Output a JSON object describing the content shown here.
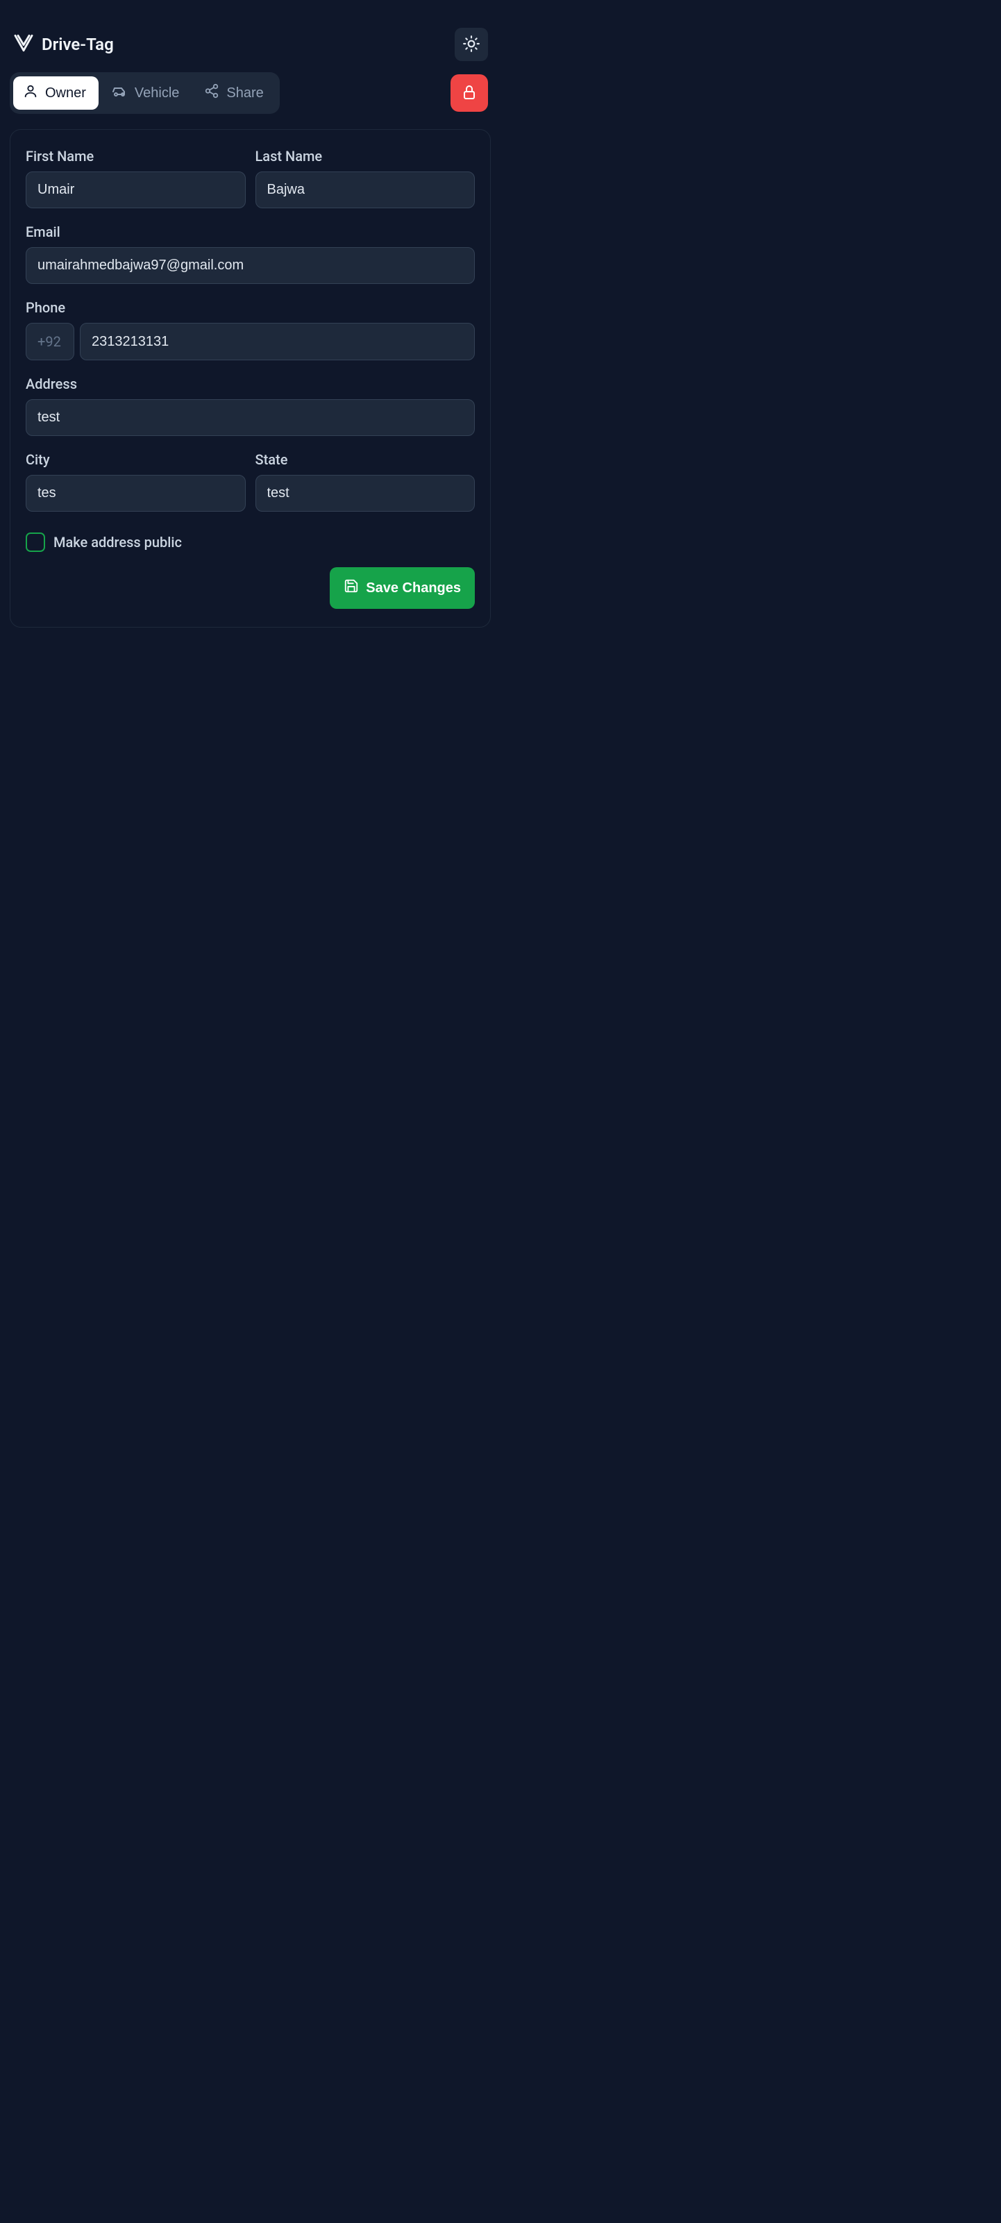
{
  "brand": {
    "title": "Drive-Tag"
  },
  "tabs": {
    "owner": "Owner",
    "vehicle": "Vehicle",
    "share": "Share"
  },
  "form": {
    "first_name": {
      "label": "First Name",
      "value": "Umair"
    },
    "last_name": {
      "label": "Last Name",
      "value": "Bajwa"
    },
    "email": {
      "label": "Email",
      "value": "umairahmedbajwa97@gmail.com"
    },
    "phone": {
      "label": "Phone",
      "prefix": "+92",
      "value": "2313213131"
    },
    "address": {
      "label": "Address",
      "value": "test"
    },
    "city": {
      "label": "City",
      "value": "tes"
    },
    "state": {
      "label": "State",
      "value": "test"
    },
    "public": {
      "label": "Make address public"
    }
  },
  "actions": {
    "save": "Save Changes"
  }
}
